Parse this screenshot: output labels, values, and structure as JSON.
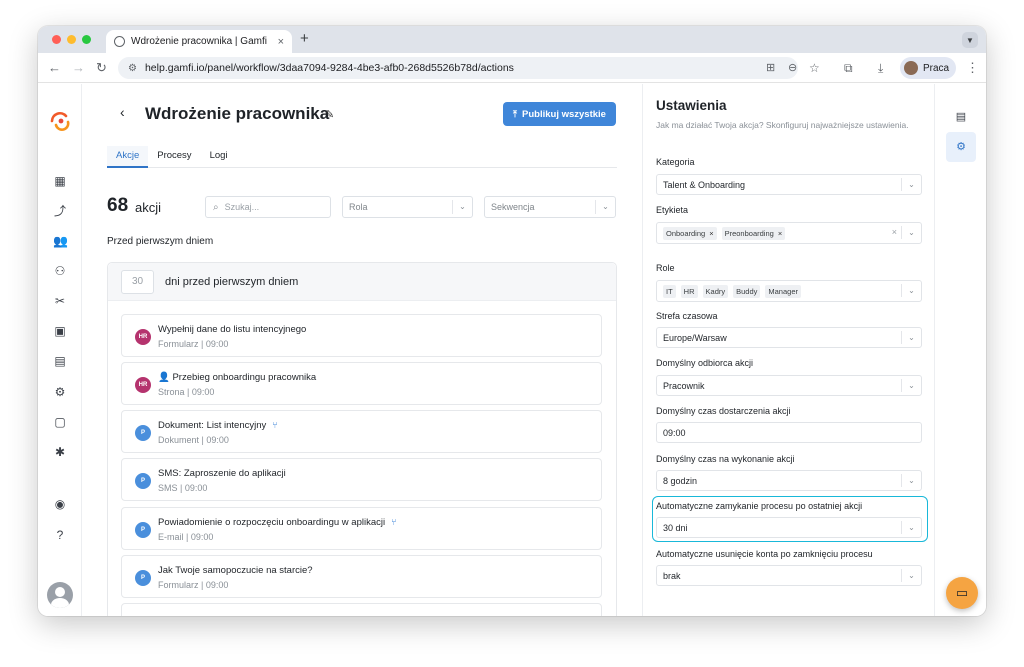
{
  "browser": {
    "tab_title": "Wdrożenie pracownika | Gamfi",
    "tab_close": "×",
    "new_tab": "+",
    "url": "help.gamfi.io/panel/workflow/3daa7094-9284-4be3-afb0-268d5526b78d/actions",
    "profile_name": "Praca",
    "traffic_colors": [
      "#ff5f57",
      "#febc2e",
      "#28c840"
    ]
  },
  "page": {
    "title": "Wdrożenie pracownika",
    "publish_label": "Publikuj wszystkie",
    "tabs": [
      {
        "label": "Akcje",
        "active": true
      },
      {
        "label": "Procesy",
        "active": false
      },
      {
        "label": "Logi",
        "active": false
      }
    ],
    "count_number": "68",
    "count_label": "akcji",
    "search_placeholder": "Szukaj...",
    "role_placeholder": "Rola",
    "sequence_placeholder": "Sekwencja",
    "section_label": "Przed pierwszym dniem",
    "group": {
      "days_value": "30",
      "days_label": "dni przed pierwszym dniem"
    },
    "items": [
      {
        "badge": "HR",
        "badge_color": "#b5336e",
        "title": "Wypełnij dane do listu intencyjnego",
        "type": "Formularz",
        "time": "09:00",
        "branch": false
      },
      {
        "badge": "HR",
        "badge_color": "#b5336e",
        "title": "👤 Przebieg onboardingu pracownika",
        "type": "Strona",
        "time": "09:00",
        "branch": false
      },
      {
        "badge": "P",
        "badge_color": "#4a8fdc",
        "title": "Dokument: List intencyjny",
        "type": "Dokument",
        "time": "09:00",
        "branch": true
      },
      {
        "badge": "P",
        "badge_color": "#4a8fdc",
        "title": "SMS: Zaproszenie do aplikacji",
        "type": "SMS",
        "time": "09:00",
        "branch": false
      },
      {
        "badge": "P",
        "badge_color": "#4a8fdc",
        "title": "Powiadomienie o rozpoczęciu onboardingu w aplikacji",
        "type": "E-mail",
        "time": "09:00",
        "branch": true
      },
      {
        "badge": "P",
        "badge_color": "#4a8fdc",
        "title": "Jak Twoje samopoczucie na starcie?",
        "type": "Formularz",
        "time": "09:00",
        "branch": false
      }
    ]
  },
  "settings": {
    "title": "Ustawienia",
    "subtitle": "Jak ma działać Twoja akcja? Skonfiguruj najważniejsze ustawienia.",
    "category_label": "Kategoria",
    "category_value": "Talent & Onboarding",
    "tag_label": "Etykieta",
    "tags": [
      "Onboarding",
      "Preonboarding"
    ],
    "role_label": "Role",
    "roles": [
      "IT",
      "HR",
      "Kadry",
      "Buddy",
      "Manager"
    ],
    "timezone_label": "Strefa czasowa",
    "timezone_value": "Europe/Warsaw",
    "recipient_label": "Domyślny odbiorca akcji",
    "recipient_value": "Pracownik",
    "delivery_label": "Domyślny czas dostarczenia akcji",
    "delivery_value": "09:00",
    "exec_label": "Domyślny czas na wykonanie akcji",
    "exec_value": "8 godzin",
    "autoclose_label": "Automatyczne zamykanie procesu po ostatniej akcji",
    "autoclose_value": "30 dni",
    "autodelete_label": "Automatyczne usunięcie konta po zamknięciu procesu",
    "autodelete_value": "brak",
    "highlight_color": "#19b8d9"
  },
  "icons": {
    "nav": [
      "dashboard-icon",
      "workflow-icon",
      "users-icon",
      "org-structure-icon",
      "tools-icon",
      "calendar-icon",
      "clipboard-icon",
      "settings-icon",
      "document-icon",
      "puzzle-icon",
      "user-circle-icon",
      "help-icon"
    ],
    "right": [
      "notes-icon",
      "gear-icon"
    ]
  }
}
